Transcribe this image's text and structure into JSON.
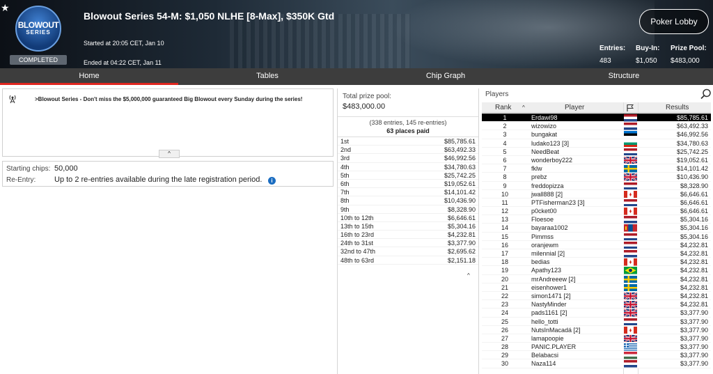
{
  "header": {
    "logo_line1": "BLOWOUT",
    "logo_line2": "SERIES",
    "status_badge": "COMPLETED",
    "title": "Blowout Series 54-M: $1,050 NLHE [8-Max], $350K Gtd",
    "started": "Started at 20:05 CET, Jan 10",
    "ended": "Ended at 04:22 CET, Jan 11",
    "lobby_button": "Poker Lobby",
    "stats": {
      "entries_label": "Entries:",
      "entries_value": "483",
      "buyin_label": "Buy-In:",
      "buyin_value": "$1,050",
      "prizepool_label": "Prize Pool:",
      "prizepool_value": "$483,000"
    }
  },
  "tabs": [
    {
      "label": "Home",
      "active": true
    },
    {
      "label": "Tables",
      "active": false
    },
    {
      "label": "Chip Graph",
      "active": false
    },
    {
      "label": "Structure",
      "active": false
    }
  ],
  "news": {
    "text": ">Blowout Series - Don't miss the $5,000,000 guaranteed Big Blowout every Sunday during the series!",
    "collapse_glyph": "^"
  },
  "info": {
    "starting_chips_label": "Starting chips:",
    "starting_chips_value": "50,000",
    "reentry_label": "Re-Entry:",
    "reentry_value": "Up to 2 re-entries available during the late registration period.",
    "info_glyph": "i"
  },
  "prizes": {
    "label": "Total prize pool:",
    "total": "$483,000.00",
    "entries_line": "(338 entries, 145 re-entries)",
    "places_paid": "63 places paid",
    "collapse_glyph": "^",
    "payouts": [
      {
        "place": "1st",
        "amount": "$85,785.61"
      },
      {
        "place": "2nd",
        "amount": "$63,492.33"
      },
      {
        "place": "3rd",
        "amount": "$46,992.56"
      },
      {
        "place": "4th",
        "amount": "$34,780.63"
      },
      {
        "place": "5th",
        "amount": "$25,742.25"
      },
      {
        "place": "6th",
        "amount": "$19,052.61"
      },
      {
        "place": "7th",
        "amount": "$14,101.42"
      },
      {
        "place": "8th",
        "amount": "$10,436.90"
      },
      {
        "place": "9th",
        "amount": "$8,328.90"
      },
      {
        "place": "10th to 12th",
        "amount": "$6,646.61"
      },
      {
        "place": "13th to 15th",
        "amount": "$5,304.16"
      },
      {
        "place": "16th to 23rd",
        "amount": "$4,232.81"
      },
      {
        "place": "24th to 31st",
        "amount": "$3,377.90"
      },
      {
        "place": "32nd to 47th",
        "amount": "$2,695.62"
      },
      {
        "place": "48th to 63rd",
        "amount": "$2,151.18"
      }
    ]
  },
  "players": {
    "label": "Players",
    "col_rank": "Rank",
    "col_sort_glyph": "^",
    "col_player": "Player",
    "col_results": "Results",
    "rows": [
      {
        "rank": "1",
        "name": "Erdawi98",
        "flag": "nl",
        "result": "$85,785.61",
        "selected": true
      },
      {
        "rank": "2",
        "name": "wizowizo",
        "flag": "nl",
        "result": "$63,492.33"
      },
      {
        "rank": "3",
        "name": "bungakat",
        "flag": "ee",
        "result": "$46,992.56"
      },
      {
        "rank": "4",
        "name": "ludako123 [3]",
        "flag": "bg",
        "result": "$34,780.63"
      },
      {
        "rank": "5",
        "name": "NeedBeat",
        "flag": "nl",
        "result": "$25,742.25"
      },
      {
        "rank": "6",
        "name": "wonderboy222",
        "flag": "uk",
        "result": "$19,052.61"
      },
      {
        "rank": "7",
        "name": "fklw",
        "flag": "se",
        "result": "$14,101.42"
      },
      {
        "rank": "8",
        "name": "prebz",
        "flag": "uk",
        "result": "$10,436.90"
      },
      {
        "rank": "9",
        "name": "freddopizza",
        "flag": "nl",
        "result": "$8,328.90"
      },
      {
        "rank": "10",
        "name": "jwall888 [2]",
        "flag": "ca",
        "result": "$6,646.61"
      },
      {
        "rank": "11",
        "name": "PTFisherman23 [3]",
        "flag": "nl",
        "result": "$6,646.61"
      },
      {
        "rank": "12",
        "name": "p0cket00",
        "flag": "ca",
        "result": "$6,646.61"
      },
      {
        "rank": "13",
        "name": "Floesoe",
        "flag": "nl",
        "result": "$5,304.16"
      },
      {
        "rank": "14",
        "name": "bayaraa1002",
        "flag": "mn",
        "result": "$5,304.16"
      },
      {
        "rank": "15",
        "name": "Pimmss",
        "flag": "nl",
        "result": "$5,304.16"
      },
      {
        "rank": "16",
        "name": "oranjewm",
        "flag": "nl",
        "result": "$4,232.81"
      },
      {
        "rank": "17",
        "name": "milennial [2]",
        "flag": "nl",
        "result": "$4,232.81"
      },
      {
        "rank": "18",
        "name": "bedias",
        "flag": "ca",
        "result": "$4,232.81"
      },
      {
        "rank": "19",
        "name": "Apathy123",
        "flag": "br",
        "result": "$4,232.81"
      },
      {
        "rank": "20",
        "name": "mrAndreeew [2]",
        "flag": "se",
        "result": "$4,232.81"
      },
      {
        "rank": "21",
        "name": "eisenhower1",
        "flag": "se",
        "result": "$4,232.81"
      },
      {
        "rank": "22",
        "name": "simon1471 [2]",
        "flag": "uk",
        "result": "$4,232.81"
      },
      {
        "rank": "23",
        "name": "NastyMinder",
        "flag": "uk",
        "result": "$4,232.81"
      },
      {
        "rank": "24",
        "name": "pads1161 [2]",
        "flag": "uk",
        "result": "$3,377.90"
      },
      {
        "rank": "25",
        "name": "hello_totti",
        "flag": "nl",
        "result": "$3,377.90"
      },
      {
        "rank": "26",
        "name": "NutsInMacadá [2]",
        "flag": "ca",
        "result": "$3,377.90"
      },
      {
        "rank": "27",
        "name": "lamapoopie",
        "flag": "uk",
        "result": "$3,377.90"
      },
      {
        "rank": "28",
        "name": "PANIC.PLAYER",
        "flag": "gr",
        "result": "$3,377.90"
      },
      {
        "rank": "29",
        "name": "Belabacsi",
        "flag": "hu",
        "result": "$3,377.90"
      },
      {
        "rank": "30",
        "name": "Naza114",
        "flag": "nl",
        "result": "$3,377.90"
      }
    ]
  },
  "colors": {
    "tab_bar": "#3d3d3d",
    "tab_active_underline": "#e0261f",
    "selected_row": "#000000",
    "info_icon": "#1b6dc1"
  }
}
